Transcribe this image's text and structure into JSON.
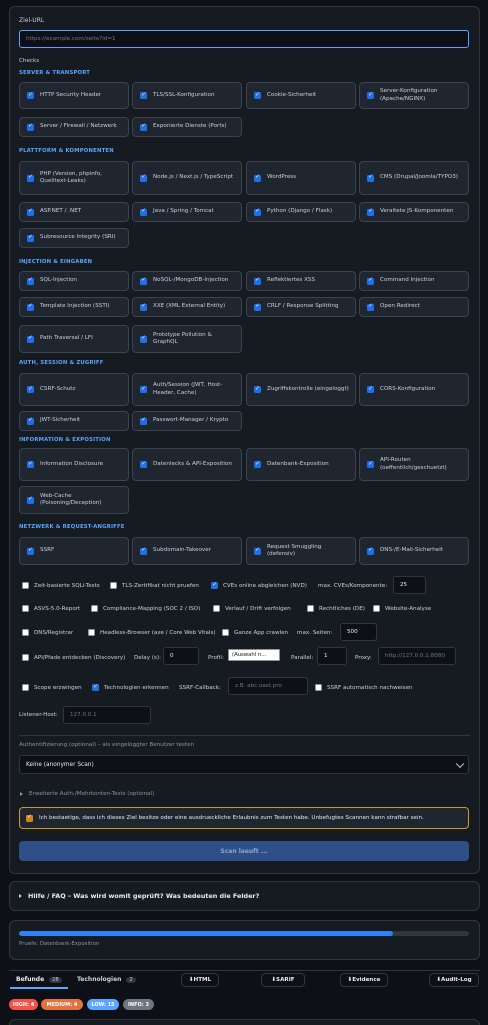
{
  "target": {
    "label": "Ziel-URL",
    "placeholder": "https://example.com/seite?id=1"
  },
  "checks_label": "Checks",
  "sections": [
    {
      "title": "SERVER & TRANSPORT",
      "items": [
        "HTTP Security Header",
        "TLS/SSL-Konfiguration",
        "Cookie-Sicherheit",
        "Server-Konfiguration (Apache/NGINX)",
        "Server / Firewall / Netzwerk",
        "Exponierte Dienste (Ports)"
      ]
    },
    {
      "title": "PLATTFORM & KOMPONENTEN",
      "items": [
        "PHP (Version, phpinfo, Quelltext-Leaks)",
        "Node.js / Next.js / TypeScript",
        "WordPress",
        "CMS (Drupal/Joomla/TYPO3)",
        "ASP.NET / .NET",
        "Java / Spring / Tomcat",
        "Python (Django / Flask)",
        "Veraltete JS-Komponenten",
        "Subresource Integrity (SRI)"
      ]
    },
    {
      "title": "INJECTION & EINGABEN",
      "items": [
        "SQL-Injection",
        "NoSQL-/MongoDB-Injection",
        "Reflektiertes XSS",
        "Command Injection",
        "Template Injection (SSTI)",
        "XXE (XML External Entity)",
        "CRLF / Response Splitting",
        "Open Redirect",
        "Path Traversal / LFI",
        "Prototype Pollution & GraphQL"
      ]
    },
    {
      "title": "AUTH, SESSION & ZUGRIFF",
      "items": [
        "CSRF-Schutz",
        "Auth/Session (JWT, Host-Header, Cache)",
        "Zugriffskontrolle (eingeloggt)",
        "CORS-Konfiguration",
        "JWT-Sicherheit",
        "Passwort-Manager / Krypto"
      ]
    },
    {
      "title": "INFORMATION & EXPOSITION",
      "items": [
        "Information Disclosure",
        "Datenlecks & API-Exposition",
        "Datenbank-Exposition",
        "API-Routen (oeffentlich/geschuetzt)",
        "Web-Cache (Poisoning/Deception)"
      ]
    },
    {
      "title": "NETZWERK & REQUEST-ANGRIFFE",
      "items": [
        "SSRF",
        "Subdomain-Takeover",
        "Request Smuggling (defensiv)",
        "DNS-/E-Mail-Sicherheit"
      ]
    }
  ],
  "options": {
    "time_sqli": "Zeit-basierte SQLi-Tests",
    "tls_skip": "TLS-Zertifikat nicht pruefen",
    "cves": "CVEs online abgleichen (NVD)",
    "max_cves_label": "max. CVEs/Komponente:",
    "max_cves": "25",
    "asvs": "ASVS-5.0-Report",
    "compliance": "Compliance-Mapping (SOC 2 / ISO)",
    "drift": "Verlauf / Drift verfolgen",
    "legal": "Rechtliches (DE)",
    "website_analysis": "Website-Analyse",
    "dns_registrar": "DNS/Registrar",
    "headless": "Headless-Browser (axe / Core Web Vitals)",
    "crawl": "Ganze App crawlen",
    "max_pages_label": "max. Seiten:",
    "max_pages": "500",
    "api_discovery": "API/Pfade entdecken (Discovery)",
    "delay_label": "Delay (s):",
    "delay": "0",
    "profile_label": "Profil:",
    "profile": "(Auswahl n...",
    "parallel_label": "Parallel:",
    "parallel": "1",
    "proxy_label": "Proxy:",
    "proxy_placeholder": "http://127.0.0.1:8080",
    "scope": "Scope erzwingen",
    "technologies": "Technologien erkennen",
    "ssrf_callback_label": "SSRF-Callback:",
    "ssrf_callback_placeholder": "z.B. abc.oast.pro",
    "ssrf_proof": "SSRF automatisch nachweisen",
    "listener_label": "Listener-Host:",
    "listener_placeholder": "127.0.0.1"
  },
  "auth": {
    "label": "Authentifizierung (optional) – als eingeloggter Benutzer testen",
    "value": "Keine (anonymer Scan)",
    "advanced": "Erweiterte Auth-/Mehrkonten-Tests (optional)"
  },
  "consent": "Ich bestaetige, dass ich dieses Ziel besitze oder eine ausdrueckliche Erlaubnis zum Testen habe. Unbefugtes Scannen kann strafbar sein.",
  "scan_button": "Scan laeuft ...",
  "help": "Hilfe / FAQ – Was wird womit geprüft? Was bedeuten die Felder?",
  "progress": {
    "status": "Pruefe: Datenbank-Exposition",
    "fraction": 0.83
  },
  "tabs": [
    {
      "label": "Befunde",
      "count": "28"
    },
    {
      "label": "Technologien",
      "count": "2"
    }
  ],
  "exports": [
    "⬇HTML",
    "⬇SARIF",
    "⬇Evidence",
    "⬇Audit-Log"
  ],
  "badges": [
    {
      "label": "HIGH: 4",
      "color": "#f85149"
    },
    {
      "label": "MEDIUM: 4",
      "color": "#e3733e"
    },
    {
      "label": "LOW: 15",
      "color": "#58a6ff"
    },
    {
      "label": "INFO: 3",
      "color": "#6e7681"
    }
  ],
  "colors": {
    "accent": "#58a6ff",
    "primary_button": "#2f4f88",
    "consent_border": "#d29922",
    "focus_border": "#58a6ff"
  }
}
